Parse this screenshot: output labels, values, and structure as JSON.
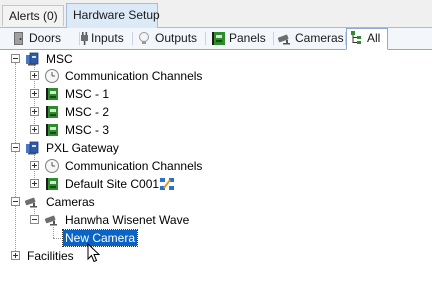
{
  "outer_tabs": [
    {
      "label": "Alerts (0)"
    },
    {
      "label": "Hardware Setup"
    }
  ],
  "inner_tabs": [
    {
      "label": "Doors",
      "icon": "door-icon"
    },
    {
      "label": "Inputs",
      "icon": "input-plug-icon"
    },
    {
      "label": "Outputs",
      "icon": "lightbulb-icon"
    },
    {
      "label": "Panels",
      "icon": "circuit-board-icon"
    },
    {
      "label": "Cameras",
      "icon": "camera-icon"
    },
    {
      "label": "All",
      "icon": "tree-icon"
    }
  ],
  "tree": {
    "msc": {
      "label": "MSC",
      "children": {
        "comm": "Communication Channels",
        "msc1": "MSC - 1",
        "msc2": "MSC - 2",
        "msc3": "MSC - 3"
      }
    },
    "pxl": {
      "label": "PXL Gateway",
      "children": {
        "comm": "Communication Channels",
        "site": "Default Site C001"
      }
    },
    "cameras": {
      "label": "Cameras",
      "children": {
        "hanwha": "Hanwha Wisenet Wave",
        "new_camera": "New Camera"
      }
    },
    "facilities": {
      "label": "Facilities"
    }
  },
  "colors": {
    "selection": "#0a64c8",
    "tab_border": "#8eaad0",
    "board_green": "#2e8b2e"
  }
}
